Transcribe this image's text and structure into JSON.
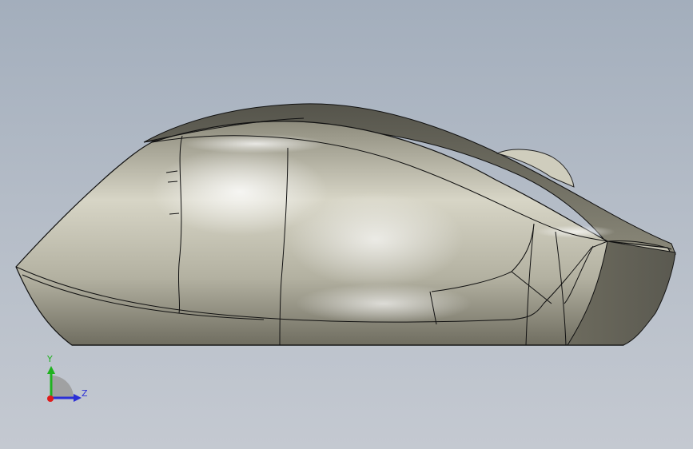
{
  "viewport": {
    "background_top": "#a3aebc",
    "background_bottom": "#c4c9d1",
    "model_color": "#c7c5b3",
    "edge_color": "#111111"
  },
  "triad": {
    "y_label": "Y",
    "z_label": "Z",
    "y_color": "#1fb21f",
    "z_color": "#2b2fd6",
    "x_color": "#e01b1b"
  }
}
